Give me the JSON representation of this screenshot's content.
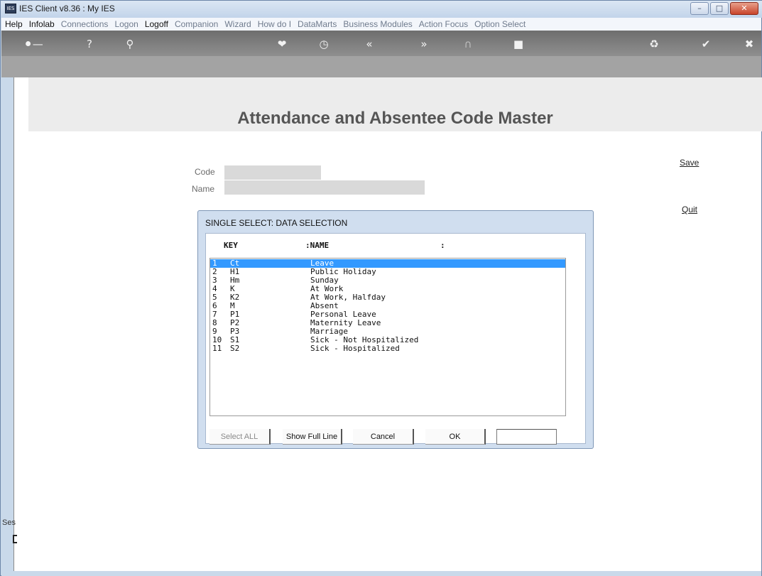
{
  "window": {
    "title": "IES Client v8.36 : My IES",
    "icon_name": "ies-app-icon",
    "controls": [
      "minimize",
      "maximize",
      "close"
    ]
  },
  "menu": [
    {
      "label": "Help",
      "active": true
    },
    {
      "label": "Infolab",
      "active": true
    },
    {
      "label": "Connections",
      "active": false
    },
    {
      "label": "Logon",
      "active": false
    },
    {
      "label": "Logoff",
      "active": true
    },
    {
      "label": "Companion",
      "active": false
    },
    {
      "label": "Wizard",
      "active": false
    },
    {
      "label": "How do I",
      "active": false
    },
    {
      "label": "DataMarts",
      "active": false
    },
    {
      "label": "Business Modules",
      "active": false
    },
    {
      "label": "Action Focus",
      "active": false
    },
    {
      "label": "Option Select",
      "active": false
    }
  ],
  "toolbar": {
    "icons": [
      "key-icon",
      "help-icon",
      "search-icon",
      "heart-icon",
      "clock-icon",
      "back-icon",
      "forward-icon",
      "trash-icon",
      "stop-icon",
      "recycle-icon",
      "check-icon",
      "close-icon"
    ]
  },
  "page": {
    "title": "Attendance and Absentee Code Master",
    "code_label": "Code",
    "name_label": "Name",
    "code_value": "",
    "name_value": "",
    "save_label": "Save",
    "quit_label": "Quit",
    "session_label": "Ses"
  },
  "dialog": {
    "title": "SINGLE SELECT: DATA SELECTION",
    "col_key": "KEY",
    "col_name": ":NAME",
    "col_extra": ":",
    "rows": [
      {
        "num": "1",
        "code": "Ct",
        "desc": "Leave",
        "selected": true
      },
      {
        "num": "2",
        "code": "H1",
        "desc": "Public Holiday",
        "selected": false
      },
      {
        "num": "3",
        "code": "Hm",
        "desc": "Sunday",
        "selected": false
      },
      {
        "num": "4",
        "code": "K",
        "desc": "At Work",
        "selected": false
      },
      {
        "num": "5",
        "code": "K2",
        "desc": "At Work, Halfday",
        "selected": false
      },
      {
        "num": "6",
        "code": "M",
        "desc": "Absent",
        "selected": false
      },
      {
        "num": "7",
        "code": "P1",
        "desc": "Personal Leave",
        "selected": false
      },
      {
        "num": "8",
        "code": "P2",
        "desc": "Maternity Leave",
        "selected": false
      },
      {
        "num": "9",
        "code": "P3",
        "desc": "Marriage",
        "selected": false
      },
      {
        "num": "10",
        "code": "S1",
        "desc": "Sick - Not Hospitalized",
        "selected": false
      },
      {
        "num": "11",
        "code": "S2",
        "desc": "Sick - Hospitalized",
        "selected": false
      }
    ],
    "buttons": {
      "select_all": "Select ALL",
      "show_full_line": "Show Full Line",
      "cancel": "Cancel",
      "ok": "OK"
    },
    "search_value": ""
  }
}
